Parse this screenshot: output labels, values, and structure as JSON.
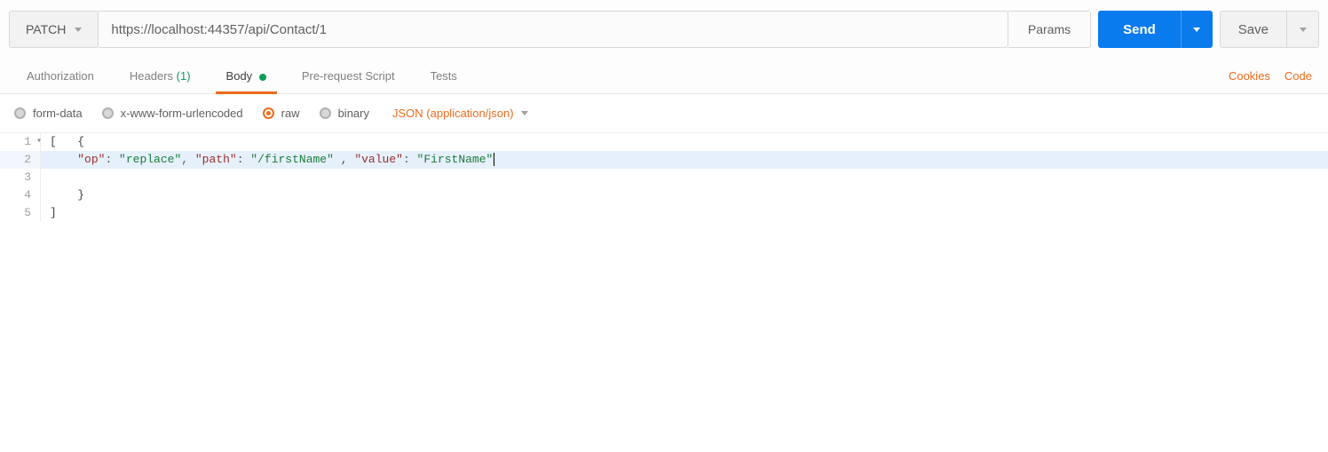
{
  "request": {
    "method": "PATCH",
    "url": "https://localhost:44357/api/Contact/1",
    "params_label": "Params",
    "send_label": "Send",
    "save_label": "Save"
  },
  "tabs": {
    "authorization": "Authorization",
    "headers": "Headers",
    "headers_count": "(1)",
    "body": "Body",
    "prerequest": "Pre-request Script",
    "tests": "Tests",
    "cookies": "Cookies",
    "code": "Code"
  },
  "body_options": {
    "form_data": "form-data",
    "urlencoded": "x-www-form-urlencoded",
    "raw": "raw",
    "binary": "binary",
    "content_type": "JSON (application/json)"
  },
  "editor": {
    "lines": {
      "l1": "[   {",
      "l2_k1": "\"op\"",
      "l2_v1": "\"replace\"",
      "l2_k2": "\"path\"",
      "l2_v2": "\"/firstName\"",
      "l2_k3": "\"value\"",
      "l2_v3": "\"FirstName\"",
      "l4": "    }",
      "l5": "]"
    }
  }
}
